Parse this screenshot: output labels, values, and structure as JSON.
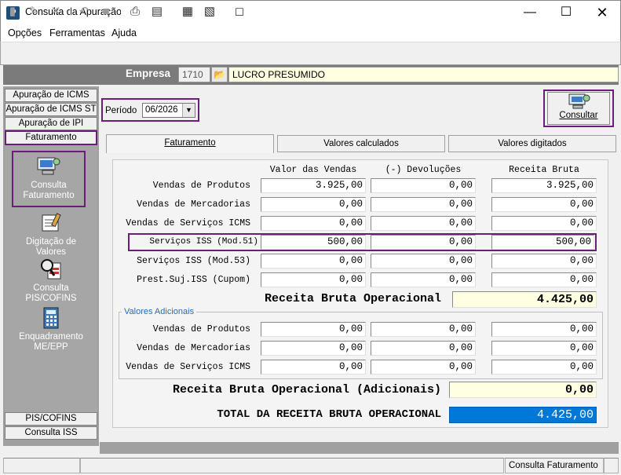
{
  "window": {
    "title": "Consulta da Apuração",
    "app_icon": "P"
  },
  "menu": [
    "Opções",
    "Ferramentas",
    "Ajuda"
  ],
  "empresa": {
    "label": "Empresa",
    "code": "1710",
    "name": "LUCRO PRESUMIDO"
  },
  "left_tabs_top": [
    "Apuração de ICMS",
    "Apuração de ICMS ST",
    "Apuração de IPI",
    "Faturamento"
  ],
  "nav_items": [
    {
      "label": "Consulta Faturamento",
      "icon": "computer-icon"
    },
    {
      "label": "Digitação de Valores",
      "icon": "notepad-icon"
    },
    {
      "label": "Consulta PIS/COFINS",
      "icon": "magnifier-document-icon"
    },
    {
      "label": "Enquadramento ME/EPP",
      "icon": "calculator-icon"
    }
  ],
  "left_tabs_bottom": [
    "PIS/COFINS",
    "Consulta ISS"
  ],
  "periodo": {
    "label": "Período",
    "value": "06/2026"
  },
  "consultar": {
    "label": "Consultar"
  },
  "tabs": [
    "Faturamento",
    "Valores calculados",
    "Valores digitados"
  ],
  "columns": [
    "Valor das Vendas",
    "(-) Devoluções",
    "Receita Bruta"
  ],
  "rows": [
    {
      "label": "Vendas de Produtos",
      "vendas": "3.925,00",
      "devol": "0,00",
      "receita": "3.925,00"
    },
    {
      "label": "Vendas de Mercadorias",
      "vendas": "0,00",
      "devol": "0,00",
      "receita": "0,00"
    },
    {
      "label": "Vendas de Serviços ICMS",
      "vendas": "0,00",
      "devol": "0,00",
      "receita": "0,00"
    },
    {
      "label": "Serviços ISS (Mod.51)",
      "vendas": "500,00",
      "devol": "0,00",
      "receita": "500,00"
    },
    {
      "label": "Serviços ISS (Mod.53)",
      "vendas": "0,00",
      "devol": "0,00",
      "receita": "0,00"
    },
    {
      "label": "Prest.Suj.ISS (Cupom)",
      "vendas": "0,00",
      "devol": "0,00",
      "receita": "0,00"
    }
  ],
  "receita_bruta": {
    "label": "Receita Bruta Operacional",
    "value": "4.425,00"
  },
  "adicionais": {
    "group_label": "Valores Adicionais",
    "rows": [
      {
        "label": "Vendas de Produtos",
        "vendas": "0,00",
        "devol": "0,00",
        "receita": "0,00"
      },
      {
        "label": "Vendas de Mercadorias",
        "vendas": "0,00",
        "devol": "0,00",
        "receita": "0,00"
      },
      {
        "label": "Vendas de Serviços ICMS",
        "vendas": "0,00",
        "devol": "0,00",
        "receita": "0,00"
      }
    ],
    "total_label": "Receita Bruta Operacional (Adicionais)",
    "total_value": "0,00"
  },
  "total": {
    "label": "TOTAL DA RECEITA BRUTA OPERACIONAL",
    "value": "4.425,00"
  },
  "status": {
    "text": "Consulta Faturamento"
  },
  "colors": {
    "highlight": "#6b1d7a",
    "total_blue": "#0078d7",
    "yellow": "#ffffe1"
  }
}
